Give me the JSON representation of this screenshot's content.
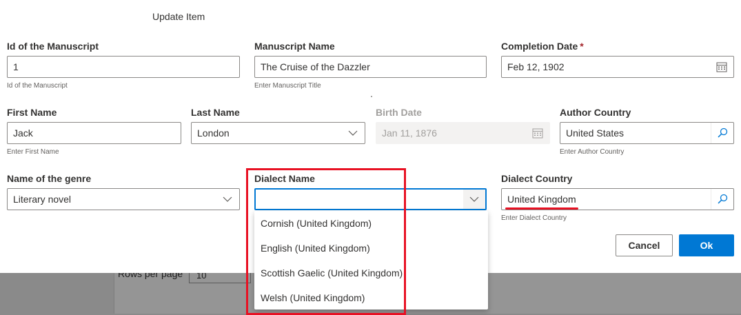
{
  "background": {
    "rows_per_page_label": "Rows per page",
    "rows_per_page_value": "10"
  },
  "dialog": {
    "title": "Update Item",
    "fields": {
      "manuscript_id": {
        "label": "Id of the Manuscript",
        "value": "1",
        "helper": "Id of the Manuscript"
      },
      "manuscript_name": {
        "label": "Manuscript Name",
        "value": "The Cruise of the Dazzler",
        "helper": "Enter Manuscript Title"
      },
      "completion_date": {
        "label": "Completion Date",
        "required_mark": "*",
        "value": "Feb 12, 1902"
      },
      "first_name": {
        "label": "First Name",
        "value": "Jack",
        "helper": "Enter First Name"
      },
      "last_name": {
        "label": "Last Name",
        "value": "London"
      },
      "birth_date": {
        "label": "Birth Date",
        "value": "Jan 11, 1876"
      },
      "author_country": {
        "label": "Author Country",
        "value": "United States",
        "helper": "Enter Author Country"
      },
      "genre": {
        "label": "Name of the genre",
        "value": "Literary novel"
      },
      "dialect_name": {
        "label": "Dialect Name",
        "value": ""
      },
      "dialect_country": {
        "label": "Dialect Country",
        "value": "United Kingdom",
        "helper": "Enter Dialect Country"
      }
    },
    "dialect_options": [
      "Cornish (United Kingdom)",
      "English (United Kingdom)",
      "Scottish Gaelic (United Kingdom)",
      "Welsh (United Kingdom)"
    ],
    "buttons": {
      "cancel": "Cancel",
      "ok": "Ok"
    }
  },
  "colors": {
    "accent": "#0078d4",
    "annotation_red": "#e81123",
    "required": "#a4262c"
  }
}
